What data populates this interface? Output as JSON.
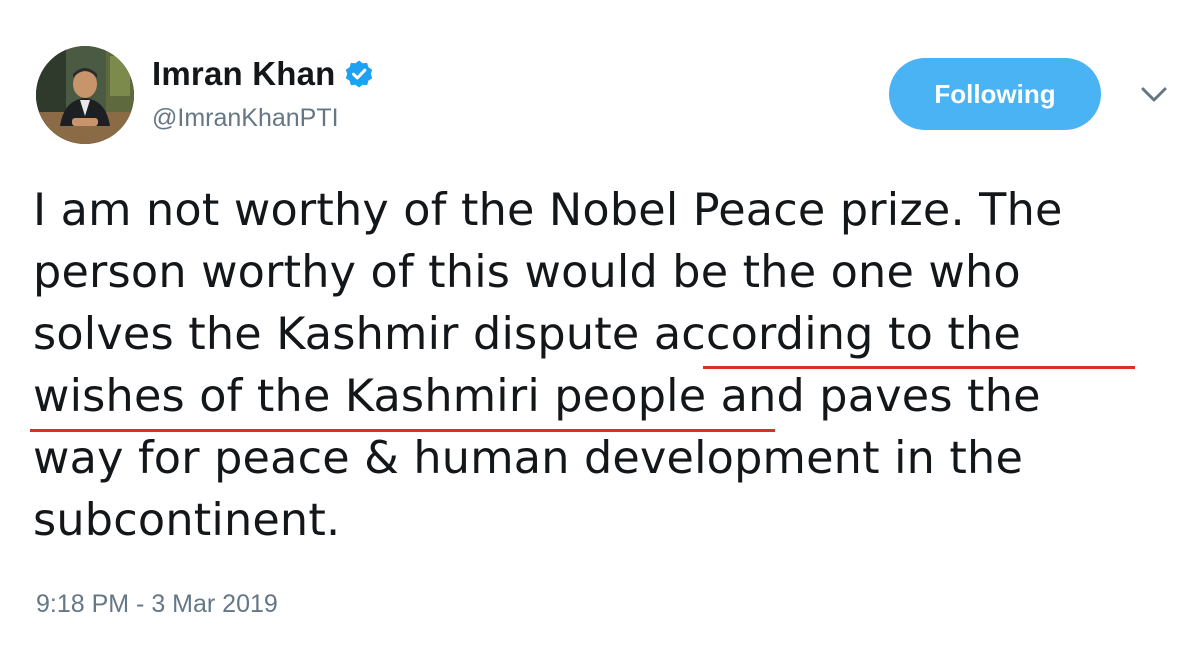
{
  "author": {
    "display_name": "Imran Khan",
    "handle": "@ImranKhanPTI",
    "verified": true
  },
  "follow_button": {
    "label": "Following"
  },
  "tweet": {
    "lines": [
      "I am not worthy of the Nobel Peace prize. The",
      "person worthy of this would be the one who",
      "solves the Kashmir dispute according to the",
      "wishes of the Kashmiri people and paves the",
      "way for peace & human development in the",
      "subcontinent."
    ],
    "underlined_phrase": "according to the wishes of the Kashmiri people",
    "timestamp": "9:18 PM - 3 Mar 2019"
  },
  "colors": {
    "accent": "#4ab3f4",
    "verified_badge": "#1da1f2",
    "underline": "#d9302b",
    "secondary_text": "#657786",
    "primary_text": "#14171a"
  },
  "icons": [
    "verified-badge-icon",
    "chevron-down-icon"
  ]
}
